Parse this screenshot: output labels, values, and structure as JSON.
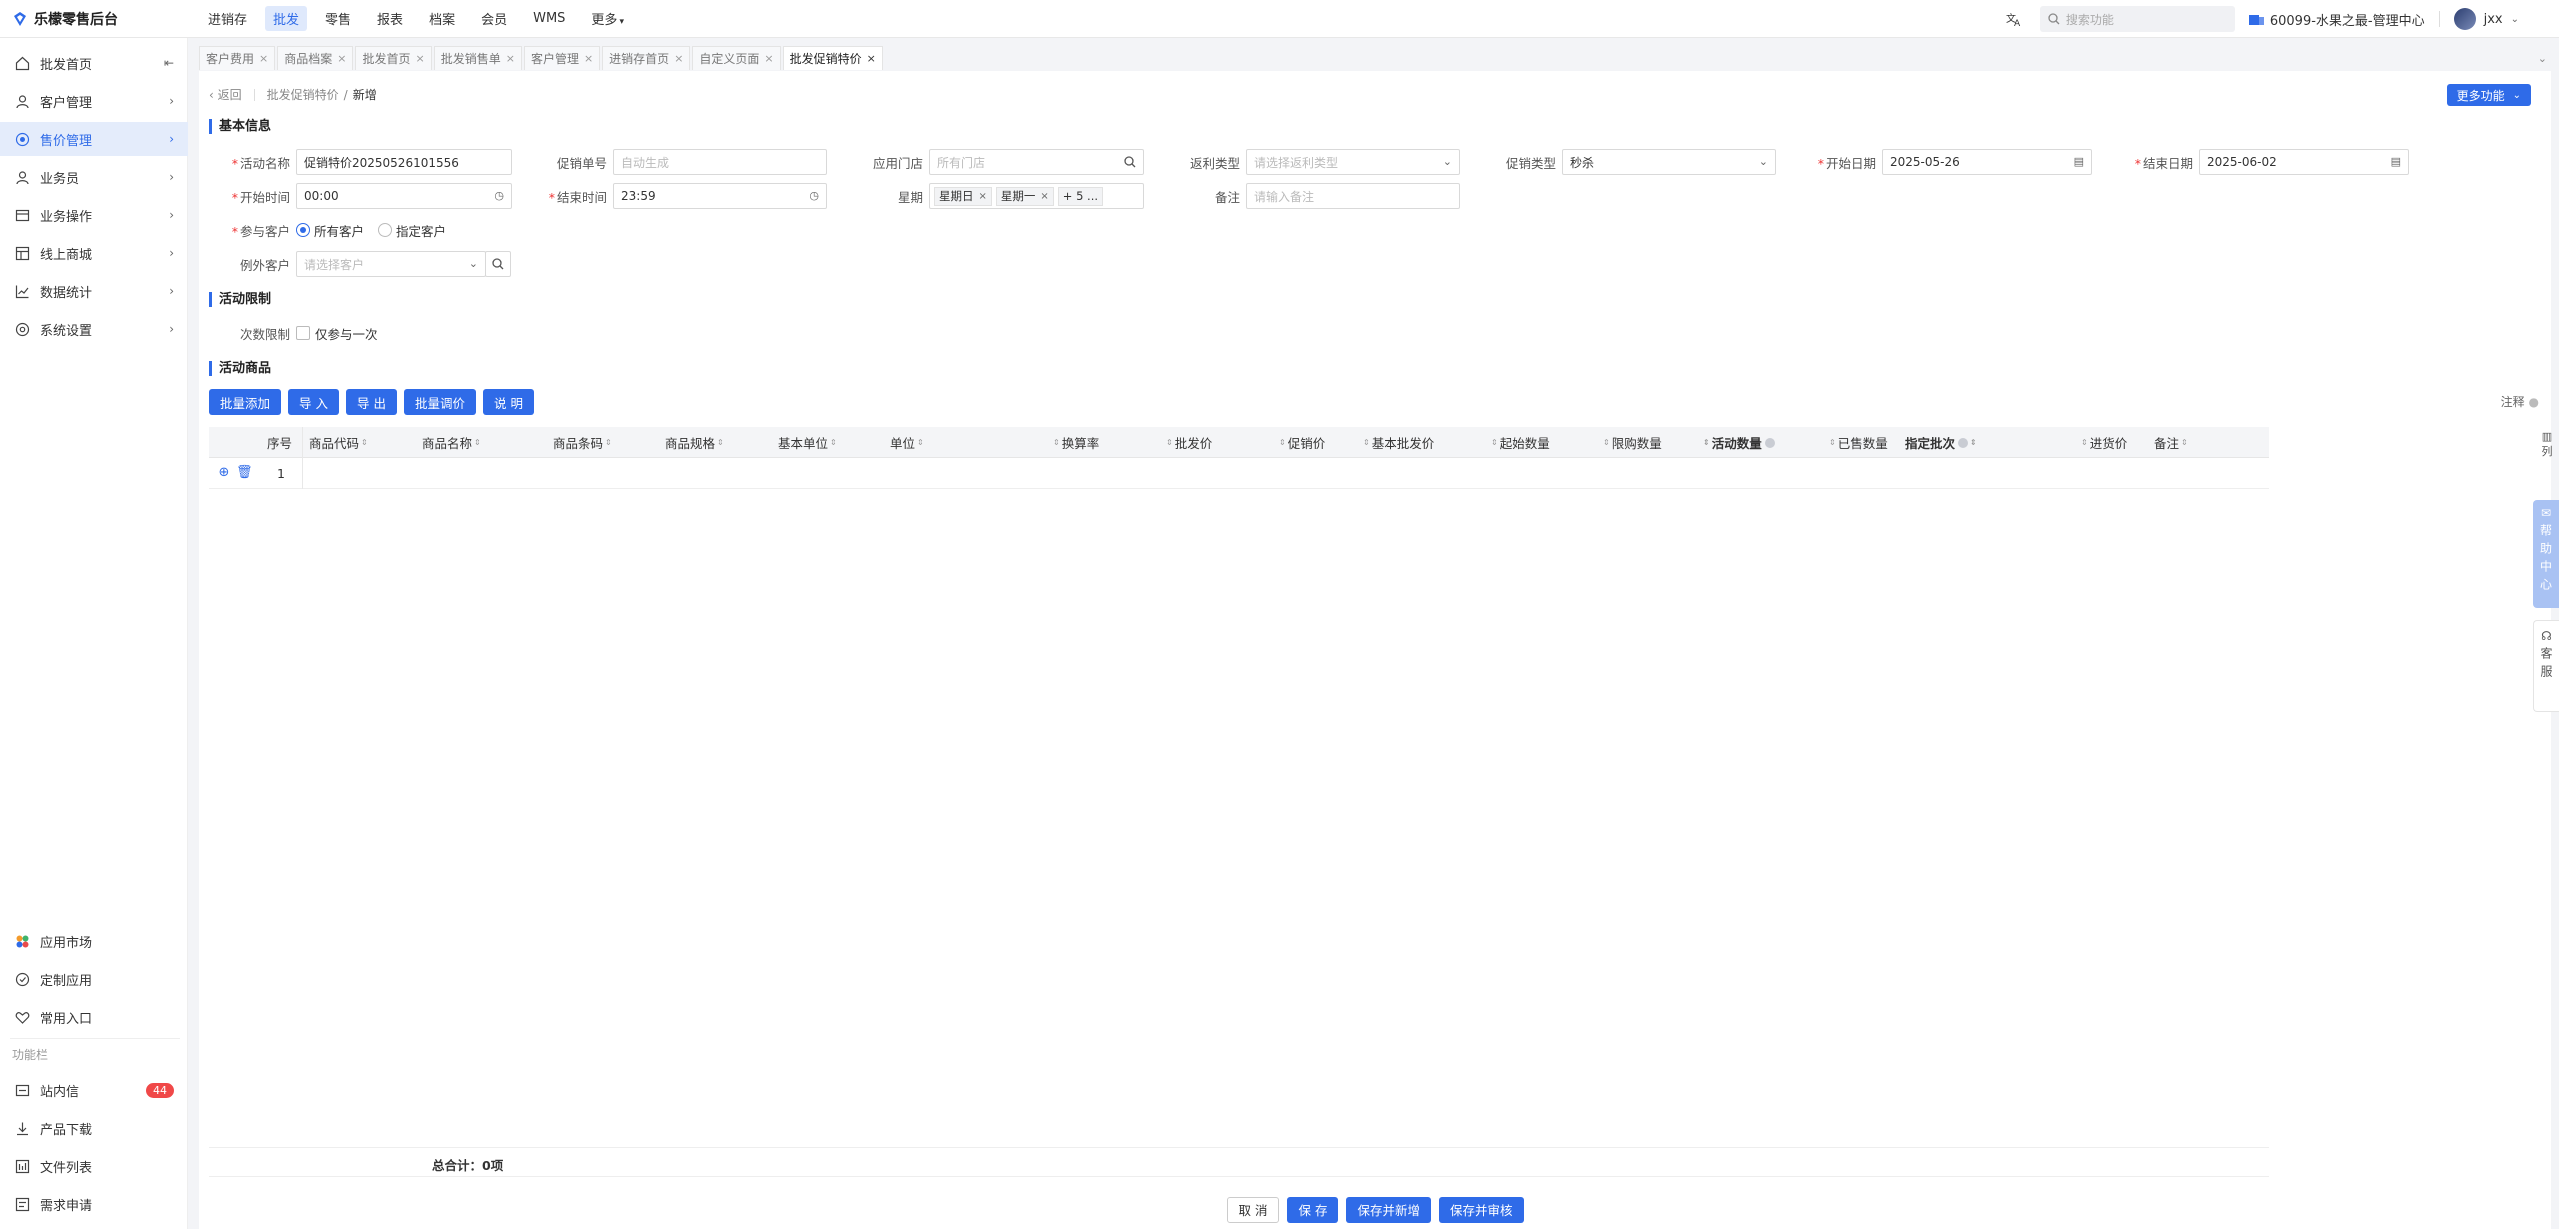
{
  "app": {
    "title": "乐檬零售后台"
  },
  "topnav": [
    {
      "label": "进销存",
      "active": false
    },
    {
      "label": "批发",
      "active": true
    },
    {
      "label": "零售",
      "active": false
    },
    {
      "label": "报表",
      "active": false
    },
    {
      "label": "档案",
      "active": false
    },
    {
      "label": "会员",
      "active": false
    },
    {
      "label": "WMS",
      "active": false
    },
    {
      "label": "更多",
      "active": false
    }
  ],
  "topbar": {
    "search_placeholder": "搜索功能",
    "store": "60099-水果之最-管理中心",
    "user": "jxx"
  },
  "sidebar": {
    "items": [
      {
        "label": "批发首页",
        "icon": "home-icon"
      },
      {
        "label": "客户管理",
        "icon": "user-icon"
      },
      {
        "label": "售价管理",
        "icon": "price-icon",
        "active": true
      },
      {
        "label": "业务员",
        "icon": "person-icon"
      },
      {
        "label": "业务操作",
        "icon": "operation-icon"
      },
      {
        "label": "线上商城",
        "icon": "store-icon"
      },
      {
        "label": "数据统计",
        "icon": "chart-icon"
      },
      {
        "label": "系统设置",
        "icon": "gear-icon"
      }
    ],
    "bottom": [
      {
        "label": "应用市场",
        "icon": "app-market-icon"
      },
      {
        "label": "定制应用",
        "icon": "custom-app-icon"
      },
      {
        "label": "常用入口",
        "icon": "heart-icon"
      }
    ],
    "function_section": "功能栏",
    "functions": [
      {
        "label": "站内信",
        "icon": "message-icon",
        "badge": "44"
      },
      {
        "label": "产品下载",
        "icon": "download-icon"
      },
      {
        "label": "文件列表",
        "icon": "file-list-icon"
      },
      {
        "label": "需求申请",
        "icon": "request-icon"
      }
    ]
  },
  "tabs": [
    {
      "label": "客户费用"
    },
    {
      "label": "商品档案"
    },
    {
      "label": "批发首页"
    },
    {
      "label": "批发销售单"
    },
    {
      "label": "客户管理"
    },
    {
      "label": "进销存首页"
    },
    {
      "label": "自定义页面"
    },
    {
      "label": "批发促销特价",
      "active": true
    }
  ],
  "breadcrumb": {
    "back": "返回",
    "parent": "批发促销特价",
    "separator": "/",
    "current": "新增"
  },
  "more_functions": "更多功能",
  "sections": {
    "basic": "基本信息",
    "limit": "活动限制",
    "goods": "活动商品"
  },
  "form": {
    "activity_name": {
      "label": "活动名称",
      "value": "促销特价20250526101556"
    },
    "promo_no": {
      "label": "促销单号",
      "placeholder": "自动生成"
    },
    "store": {
      "label": "应用门店",
      "placeholder": "所有门店"
    },
    "rebate_type": {
      "label": "返利类型",
      "placeholder": "请选择返利类型"
    },
    "promo_type": {
      "label": "促销类型",
      "value": "秒杀"
    },
    "start_date": {
      "label": "开始日期",
      "value": "2025-05-26"
    },
    "end_date": {
      "label": "结束日期",
      "value": "2025-06-02"
    },
    "start_time": {
      "label": "开始时间",
      "value": "00:00"
    },
    "end_time": {
      "label": "结束时间",
      "value": "23:59"
    },
    "weekday": {
      "label": "星期",
      "tags": [
        "星期日",
        "星期一"
      ],
      "more": "+ 5 ..."
    },
    "remark": {
      "label": "备注",
      "placeholder": "请输入备注"
    },
    "customers": {
      "label": "参与客户",
      "options": [
        "所有客户",
        "指定客户"
      ],
      "selected": "所有客户"
    },
    "except_customers": {
      "label": "例外客户",
      "placeholder": "请选择客户"
    },
    "times_limit": {
      "label": "次数限制",
      "option": "仅参与一次"
    }
  },
  "actions": [
    "批量添加",
    "导 入",
    "导 出",
    "批量调价",
    "说 明"
  ],
  "annotation": "注释",
  "table": {
    "headers": [
      "序号",
      "商品代码",
      "商品名称",
      "商品条码",
      "商品规格",
      "基本单位",
      "单位",
      "换算率",
      "批发价",
      "促销价",
      "基本批发价",
      "起始数量",
      "限购数量",
      "活动数量",
      "已售数量",
      "指定批次",
      "进货价",
      "备注"
    ],
    "rows": [
      {
        "index": "1"
      }
    ],
    "total": "总合计：0项"
  },
  "footer": [
    "取 消",
    "保 存",
    "保存并新增",
    "保存并审核"
  ],
  "right_float": {
    "columns": "列",
    "help": "帮助中心",
    "service": "客服"
  },
  "colors": {
    "accent": "#2f6be8",
    "badge": "#f04848"
  }
}
